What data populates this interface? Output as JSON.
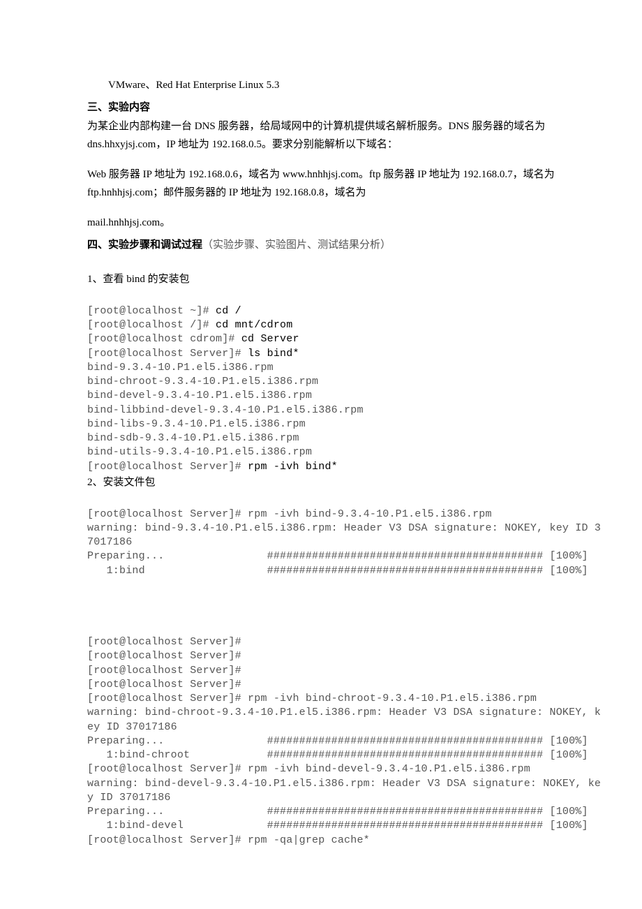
{
  "env": "VMware、Red Hat Enterprise Linux 5.3",
  "section3": {
    "heading": "三、实验内容",
    "p1": "为某企业内部构建一台 DNS 服务器，给局域网中的计算机提供域名解析服务。DNS 服务器的域名为 dns.hhxyjsj.com，IP 地址为 192.168.0.5。要求分别能解析以下域名：",
    "p2": "Web 服务器 IP 地址为 192.168.0.6，域名为 www.hnhhjsj.com。ftp 服务器 IP 地址为 192.168.0.7，域名为 ftp.hnhhjsj.com；邮件服务器的 IP 地址为 192.168.0.8，域名为",
    "p3": "mail.hnhhjsj.com。"
  },
  "section4": {
    "heading": "四、实验步骤和调试过程",
    "heading_note": "（实验步骤、实验图片、测试结果分析）"
  },
  "step1": {
    "title": "1、查看 bind 的安装包",
    "lines": {
      "l1p": "[root@localhost ~]# ",
      "l1c": "cd /",
      "l2p": "[root@localhost /]# ",
      "l2c": "cd mnt/cdrom",
      "l3p": "[root@localhost cdrom]# ",
      "l3c": "cd Server",
      "l4p": "[root@localhost Server]# ",
      "l4c": "ls bind*",
      "f1": "bind-9.3.4-10.P1.el5.i386.rpm",
      "f2": "bind-chroot-9.3.4-10.P1.el5.i386.rpm",
      "f3": "bind-devel-9.3.4-10.P1.el5.i386.rpm",
      "f4": "bind-libbind-devel-9.3.4-10.P1.el5.i386.rpm",
      "f5": "bind-libs-9.3.4-10.P1.el5.i386.rpm",
      "f6": "bind-sdb-9.3.4-10.P1.el5.i386.rpm",
      "f7": "bind-utils-9.3.4-10.P1.el5.i386.rpm",
      "l5p": "[root@localhost Server]# ",
      "l5c": "rpm -ivh bind*"
    }
  },
  "step2": {
    "title": "2、安装文件包",
    "block1": {
      "l1": "[root@localhost Server]# rpm -ivh bind-9.3.4-10.P1.el5.i386.rpm",
      "l2": "warning: bind-9.3.4-10.P1.el5.i386.rpm: Header V3 DSA signature: NOKEY, key ID 3",
      "l3": "7017186",
      "l4": "Preparing...                ########################################### [100%]",
      "l5": "   1:bind                   ########################################### [100%]"
    },
    "emptyPrompts": {
      "p1": "[root@localhost Server]#",
      "p2": "[root@localhost Server]#",
      "p3": "[root@localhost Server]#",
      "p4": "[root@localhost Server]#"
    },
    "block2": {
      "l1": "[root@localhost Server]# rpm -ivh bind-chroot-9.3.4-10.P1.el5.i386.rpm",
      "l2": "warning: bind-chroot-9.3.4-10.P1.el5.i386.rpm: Header V3 DSA signature: NOKEY, k",
      "l3": "ey ID 37017186",
      "l4": "Preparing...                ########################################### [100%]",
      "l5": "   1:bind-chroot            ########################################### [100%]"
    },
    "block3": {
      "l1": "[root@localhost Server]# rpm -ivh bind-devel-9.3.4-10.P1.el5.i386.rpm",
      "l2": "warning: bind-devel-9.3.4-10.P1.el5.i386.rpm: Header V3 DSA signature: NOKEY, ke",
      "l3": "y ID 37017186",
      "l4": "Preparing...                ########################################### [100%]",
      "l5": "   1:bind-devel             ########################################### [100%]"
    },
    "tail": "[root@localhost Server]# rpm -qa|grep cache*"
  }
}
